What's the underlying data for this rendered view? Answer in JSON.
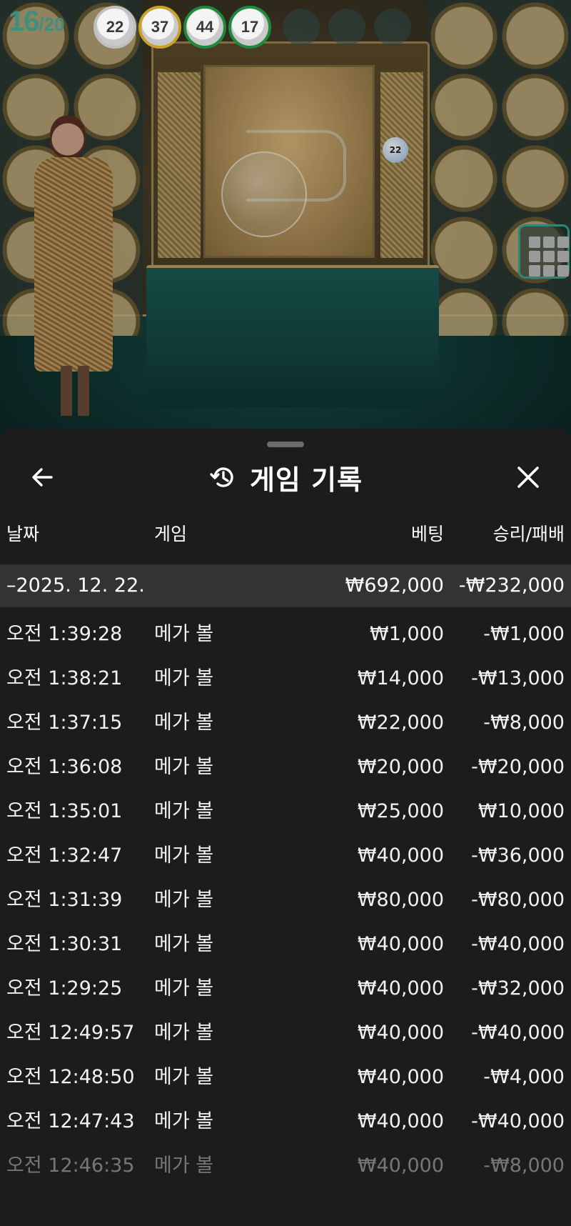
{
  "tracker": {
    "current": "16",
    "total": "/20",
    "balls": [
      "22",
      "37",
      "44",
      "17"
    ],
    "ball_colors": [
      "#bfbfbf",
      "#c8a12a",
      "#1f8a3d",
      "#1f8a3d"
    ]
  },
  "stage": {
    "cabinet_ball": "22"
  },
  "panel": {
    "title": "게임 기록",
    "columns": {
      "date": "날짜",
      "game": "게임",
      "bet": "베팅",
      "result": "승리/패배"
    },
    "summary": {
      "date": "–2025. 12. 22.",
      "bet": "₩692,000",
      "result": "-₩232,000"
    },
    "rows": [
      {
        "time": "오전 1:39:28",
        "game": "메가 볼",
        "bet": "₩1,000",
        "result": "-₩1,000"
      },
      {
        "time": "오전 1:38:21",
        "game": "메가 볼",
        "bet": "₩14,000",
        "result": "-₩13,000"
      },
      {
        "time": "오전 1:37:15",
        "game": "메가 볼",
        "bet": "₩22,000",
        "result": "-₩8,000"
      },
      {
        "time": "오전 1:36:08",
        "game": "메가 볼",
        "bet": "₩20,000",
        "result": "-₩20,000"
      },
      {
        "time": "오전 1:35:01",
        "game": "메가 볼",
        "bet": "₩25,000",
        "result": "₩10,000"
      },
      {
        "time": "오전 1:32:47",
        "game": "메가 볼",
        "bet": "₩40,000",
        "result": "-₩36,000"
      },
      {
        "time": "오전 1:31:39",
        "game": "메가 볼",
        "bet": "₩80,000",
        "result": "-₩80,000"
      },
      {
        "time": "오전 1:30:31",
        "game": "메가 볼",
        "bet": "₩40,000",
        "result": "-₩40,000"
      },
      {
        "time": "오전 1:29:25",
        "game": "메가 볼",
        "bet": "₩40,000",
        "result": "-₩32,000"
      },
      {
        "time": "오전 12:49:57",
        "game": "메가 볼",
        "bet": "₩40,000",
        "result": "-₩40,000"
      },
      {
        "time": "오전 12:48:50",
        "game": "메가 볼",
        "bet": "₩40,000",
        "result": "-₩4,000"
      },
      {
        "time": "오전 12:47:43",
        "game": "메가 볼",
        "bet": "₩40,000",
        "result": "-₩40,000"
      },
      {
        "time": "오전 12:46:35",
        "game": "메가 볼",
        "bet": "₩40,000",
        "result": "-₩8,000"
      }
    ],
    "icons": {
      "back": "arrow-left-icon",
      "history": "history-icon",
      "close": "close-icon"
    }
  }
}
